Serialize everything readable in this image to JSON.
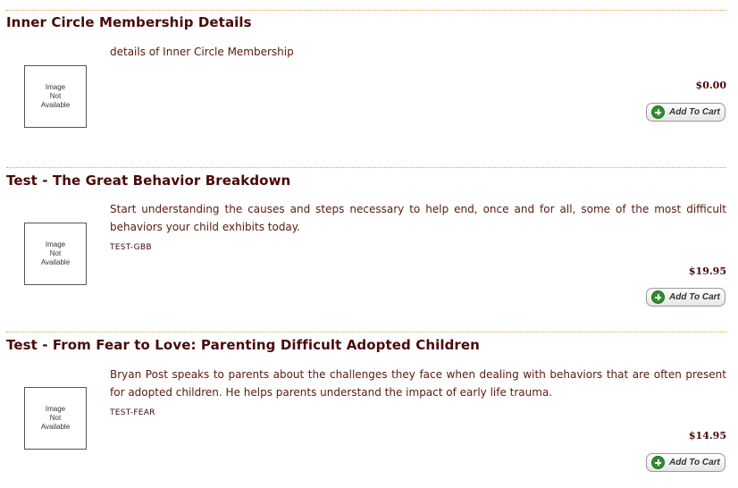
{
  "image_placeholder_text": "Image\nNot\nAvailable",
  "add_to_cart_label": "Add To Cart",
  "products": [
    {
      "title": "Inner Circle Membership Details",
      "description": "details of Inner Circle Membership",
      "sku": "",
      "price": "$0.00"
    },
    {
      "title": "Test - The Great Behavior Breakdown",
      "description": "Start understanding the causes and steps necessary to help end, once and for all, some of the most difficult behaviors your child exhibits today.",
      "sku": "TEST-GBB",
      "price": "$19.95"
    },
    {
      "title": "Test - From Fear to Love: Parenting Difficult Adopted Children",
      "description": "Bryan Post speaks to parents about the challenges they face when dealing with behaviors that are often present for adopted children. He helps parents understand the impact of early life trauma.",
      "sku": "TEST-FEAR",
      "price": "$14.95"
    }
  ]
}
